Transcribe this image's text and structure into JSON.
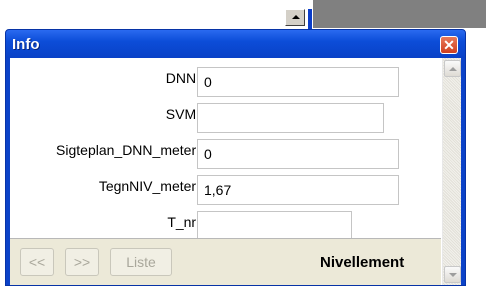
{
  "window": {
    "title": "Info",
    "close_glyph": "✕"
  },
  "form": {
    "fields": [
      {
        "label": "DNN:",
        "value": "0"
      },
      {
        "label": "SVM:",
        "value": ""
      },
      {
        "label": "Sigteplan_DNN_meter:",
        "value": "0"
      },
      {
        "label": "TegnNIV_meter:",
        "value": "1,67"
      },
      {
        "label": "T_nr:",
        "value": ""
      }
    ]
  },
  "toolbar": {
    "prev_label": "<<",
    "next_label": ">>",
    "list_label": "Liste",
    "layer_name": "Nivellement"
  },
  "colors": {
    "titlebar": "#0b42c8",
    "close_button": "#d9532f",
    "toolbar_bg": "#ece9d8"
  }
}
